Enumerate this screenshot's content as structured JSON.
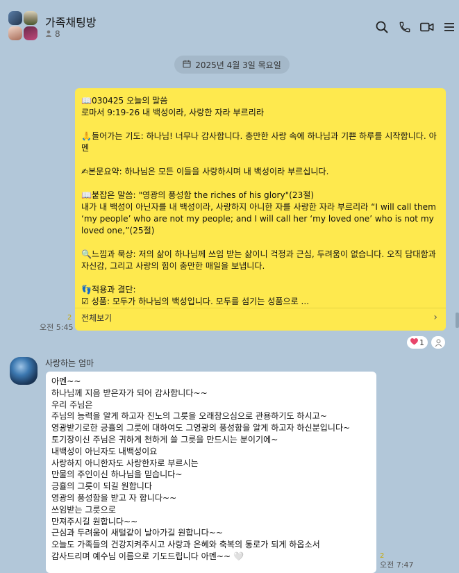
{
  "header": {
    "title": "가족채팅방",
    "member_count": "8"
  },
  "date_divider": "2025년 4월 3일 목요일",
  "messages": [
    {
      "content": "📖030425 오늘의 말씀\n로마서 9:19-26 내 백성이라, 사랑한 자라 부르리라\n\n🙏들어가는 기도: 하나님! 너무나 감사합니다. 충만한 사랑 속에 하나님과 기쁜 하루를 시작합니다. 아멘\n\n✍본문요약: 하나님은 모든 이들을 사랑하시며 내 백성이라 부르십니다.\n\n📖붙잡은 말씀: \"영광의 풍성함 the riches of his glory\"(23절)\n내가 내 백성이 아닌자를 내 백성이라, 사랑하지 아니한 자를 사랑한 자라 부르리라 “I will call them ‘my people’ who are not my people; and I will call her ‘my loved one’ who is not my loved one,”(25절)\n\n🔍느낌과 묵상: 저의 삶이 하나님께 쓰임 받는 삶이니 걱정과 근심, 두려움이 없습니다. 오직 담대함과 자신감, 그리고 사랑의 힘이 충만한 매일을 보냅니다.\n\n👣적용과 결단:\n☑ 성품: 모두가 하나님의 백성입니다. 모두를 섬기는 성품으로 ...",
      "more_label": "전체보기",
      "read_count": "2",
      "time": "오전 5:45",
      "reaction_count": "1"
    },
    {
      "sender": "사랑하는 엄마",
      "content": "아멘~~\n하나님께 지음 받은자가 되어 감사합니다~~\n우리 주님은\n주님의 능력을 알게 하고자 진노의 그릇을 오래참으심으로 관용하기도 하시고~\n영광받기로한 긍휼의 그릇에 대하여도 그영광의 풍성함을 알게 하고자 하신분입니다~\n토기장이신 주님은 귀하게 천하게 쓸 그릇을 만드시는 분이기에~\n내백성이 아닌자도 내백성이요\n사랑하지 아니한자도 사랑한자로 부르시는\n만물의 주인이신 하나님을 믿습니다~\n긍휼의 그릇이 되길 원합니다\n영광의 풍성함을 받고 자 합니다~~\n쓰임받는 그릇으로\n만져주시길 원합니다~~\n근심과 두려움이 새털같이 날아가길 원합니다~~\n오늘도 가족들의 건강지켜주시고 사랑과 은혜와 축복의 통로가 되게 하옵소서\n감사드리며 예수님 이름으로 기도드립니다 아멘~~ 🤍",
      "read_count": "2",
      "time": "오전 7:47"
    }
  ],
  "icons": [
    "search-icon",
    "phone-icon",
    "video-call-icon",
    "menu-icon",
    "person-icon",
    "calendar-icon",
    "heart-icon",
    "add-reaction-icon",
    "chevron-right-icon"
  ],
  "colors": {
    "background": "#b2c7d9",
    "my_bubble": "#fee94e",
    "their_bubble": "#ffffff",
    "heart": "#e8456b"
  }
}
